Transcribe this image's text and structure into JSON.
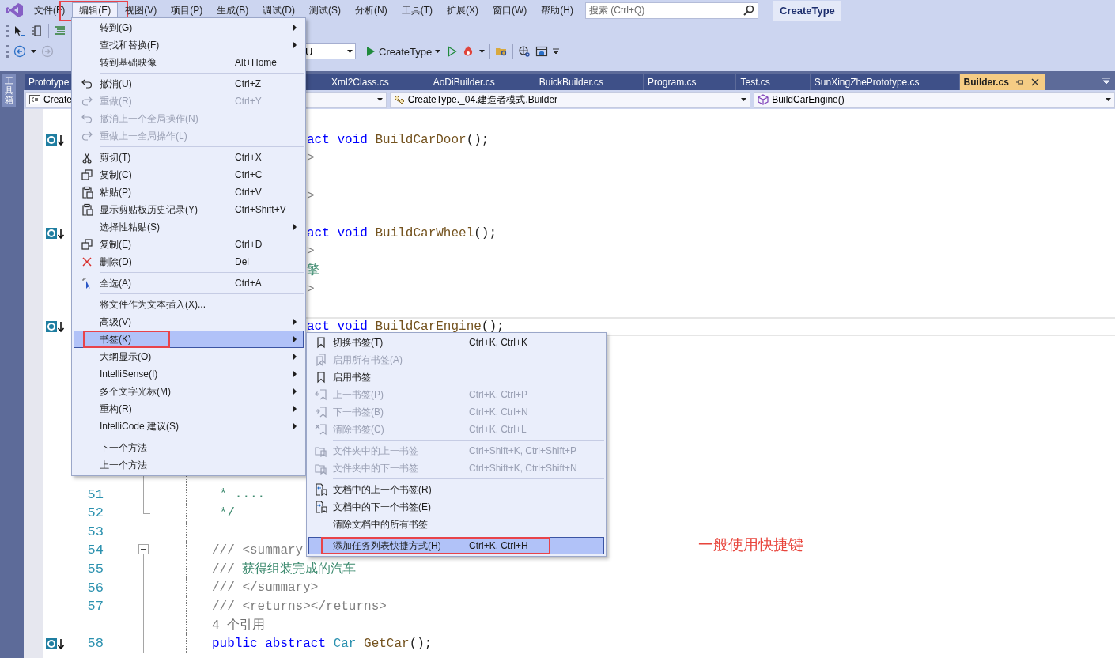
{
  "menu_bar": {
    "items": [
      {
        "label": "文件(F)",
        "selected": false,
        "annotated": false
      },
      {
        "label": "编辑(E)",
        "selected": true,
        "annotated": true
      },
      {
        "label": "视图(V)",
        "selected": false,
        "annotated": false
      },
      {
        "label": "项目(P)",
        "selected": false,
        "annotated": false
      },
      {
        "label": "生成(B)",
        "selected": false,
        "annotated": false
      },
      {
        "label": "调试(D)",
        "selected": false,
        "annotated": false
      },
      {
        "label": "测试(S)",
        "selected": false,
        "annotated": false
      },
      {
        "label": "分析(N)",
        "selected": false,
        "annotated": false
      },
      {
        "label": "工具(T)",
        "selected": false,
        "annotated": false
      },
      {
        "label": "扩展(X)",
        "selected": false,
        "annotated": false
      },
      {
        "label": "窗口(W)",
        "selected": false,
        "annotated": false
      },
      {
        "label": "帮助(H)",
        "selected": false,
        "annotated": false
      }
    ],
    "search": {
      "placeholder": "搜索 (Ctrl+Q)"
    },
    "solution_name": "CreateType"
  },
  "toolbar": {
    "config_dropdown": {
      "value": "U"
    },
    "start_button": {
      "label": "CreateType"
    }
  },
  "toolbox_tab": {
    "label": "工具箱"
  },
  "tabs": [
    {
      "label": "Prototype",
      "selected": false
    },
    {
      "label": "Xml2Class.cs",
      "selected": false
    },
    {
      "label": "AoDiBuilder.cs",
      "selected": false
    },
    {
      "label": "BuickBuilder.cs",
      "selected": false
    },
    {
      "label": "Program.cs",
      "selected": false
    },
    {
      "label": "Test.cs",
      "selected": false
    },
    {
      "label": "SunXingZhePrototype.cs",
      "selected": false
    },
    {
      "label": "Builder.cs",
      "selected": true
    }
  ],
  "nav_bar": [
    {
      "kind": "project",
      "value": "Create"
    },
    {
      "kind": "class",
      "value": "CreateType._04.建造者模式.Builder"
    },
    {
      "kind": "method",
      "value": "BuildCarEngine()"
    }
  ],
  "editor": {
    "lines": [
      {
        "kind": "clipped",
        "marker": true,
        "current": false,
        "tokens": [
          {
            "kind": "keyword",
            "text": "act void "
          },
          {
            "kind": "method",
            "text": "BuildCarDoor"
          },
          {
            "kind": "plain",
            "text": "();"
          }
        ]
      },
      {
        "kind": "clipped",
        "marker": false,
        "current": false,
        "tokens": [
          {
            "kind": "doc",
            "text": ">"
          }
        ]
      },
      {
        "kind": "blank",
        "marker": false,
        "current": false
      },
      {
        "kind": "clipped",
        "marker": false,
        "current": false,
        "tokens": [
          {
            "kind": "doc",
            "text": ">"
          }
        ]
      },
      {
        "kind": "blank",
        "marker": false,
        "current": false
      },
      {
        "kind": "clipped",
        "marker": true,
        "current": false,
        "tokens": [
          {
            "kind": "keyword",
            "text": "act void "
          },
          {
            "kind": "method",
            "text": "BuildCarWheel"
          },
          {
            "kind": "plain",
            "text": "();"
          }
        ]
      },
      {
        "kind": "clipped",
        "marker": false,
        "current": false,
        "tokens": [
          {
            "kind": "doc",
            "text": ">"
          }
        ]
      },
      {
        "kind": "clipped",
        "marker": false,
        "current": false,
        "tokens": [
          {
            "kind": "comment",
            "text": "擎"
          }
        ]
      },
      {
        "kind": "clipped",
        "marker": false,
        "current": false,
        "tokens": [
          {
            "kind": "doc",
            "text": ">"
          }
        ]
      },
      {
        "kind": "blank",
        "marker": false,
        "current": false
      },
      {
        "kind": "clipped",
        "marker": true,
        "current": true,
        "tokens": [
          {
            "kind": "keyword",
            "text": "act void "
          },
          {
            "kind": "method",
            "text": "BuildCarEngine"
          },
          {
            "kind": "plain",
            "text": "();"
          }
        ]
      },
      {
        "kind": "blank",
        "marker": false,
        "current": false
      },
      {
        "kind": "blank",
        "marker": false,
        "current": false
      },
      {
        "kind": "blank",
        "marker": false,
        "current": false
      },
      {
        "kind": "blank",
        "marker": false,
        "current": false
      },
      {
        "kind": "blank",
        "marker": false,
        "current": false
      },
      {
        "kind": "blank",
        "marker": false,
        "current": false
      },
      {
        "kind": "blank",
        "marker": false,
        "current": false
      },
      {
        "kind": "blank",
        "marker": false,
        "current": false
      },
      {
        "kind": "full",
        "number": "51",
        "marker": false,
        "current": false,
        "tokens": [
          {
            "kind": "comment",
            "text": " * ...."
          }
        ]
      },
      {
        "kind": "full",
        "number": "52",
        "marker": false,
        "current": false,
        "fold": {
          "kind": "end"
        },
        "tokens": [
          {
            "kind": "comment",
            "text": " */"
          }
        ]
      },
      {
        "kind": "full",
        "number": "53",
        "marker": false,
        "current": false,
        "fold": {
          "kind": "gap"
        }
      },
      {
        "kind": "full",
        "number": "54",
        "marker": false,
        "current": false,
        "fold": {
          "kind": "start"
        },
        "tokens": [
          {
            "kind": "doc",
            "text": "/// <summary"
          }
        ]
      },
      {
        "kind": "full",
        "number": "55",
        "marker": false,
        "current": false,
        "tokens": [
          {
            "kind": "doc",
            "text": "/// "
          },
          {
            "kind": "comment",
            "text": "获得组装完成的汽车"
          }
        ]
      },
      {
        "kind": "full",
        "number": "56",
        "marker": false,
        "current": false,
        "tokens": [
          {
            "kind": "doc",
            "text": "/// </summary>"
          }
        ]
      },
      {
        "kind": "full",
        "number": "57",
        "marker": false,
        "current": false,
        "tokens": [
          {
            "kind": "doc",
            "text": "/// <returns></returns>"
          }
        ]
      },
      {
        "kind": "lens",
        "marker": false,
        "current": false,
        "tokens": [
          {
            "kind": "lens",
            "text": "4 个引用"
          }
        ]
      },
      {
        "kind": "full",
        "number": "58",
        "marker": true,
        "current": false,
        "tokens": [
          {
            "kind": "keyword",
            "text": "public abstract "
          },
          {
            "kind": "type",
            "text": "Car "
          },
          {
            "kind": "method",
            "text": "GetCar"
          },
          {
            "kind": "plain",
            "text": "();"
          }
        ]
      }
    ],
    "note": "一般使用快捷键"
  },
  "edit_menu": {
    "items": [
      {
        "kind": "item",
        "label": "转到(G)",
        "disabled": false,
        "submenu": true,
        "selected": false,
        "annotated": false
      },
      {
        "kind": "item",
        "label": "查找和替换(F)",
        "disabled": false,
        "submenu": true,
        "selected": false,
        "annotated": false
      },
      {
        "kind": "item",
        "label": "转到基础映像",
        "shortcut": "Alt+Home",
        "disabled": false,
        "submenu": false,
        "selected": false,
        "annotated": false
      },
      {
        "kind": "separator"
      },
      {
        "kind": "item",
        "label": "撤消(U)",
        "shortcut": "Ctrl+Z",
        "disabled": false,
        "submenu": false,
        "selected": false,
        "annotated": false
      },
      {
        "kind": "item",
        "label": "重做(R)",
        "shortcut": "Ctrl+Y",
        "disabled": true,
        "submenu": false,
        "selected": false,
        "annotated": false
      },
      {
        "kind": "item",
        "label": "撤消上一个全局操作(N)",
        "disabled": true,
        "submenu": false,
        "selected": false,
        "annotated": false
      },
      {
        "kind": "item",
        "label": "重做上一全局操作(L)",
        "disabled": true,
        "submenu": false,
        "selected": false,
        "annotated": false
      },
      {
        "kind": "separator"
      },
      {
        "kind": "item",
        "label": "剪切(T)",
        "shortcut": "Ctrl+X",
        "disabled": false,
        "submenu": false,
        "selected": false,
        "annotated": false
      },
      {
        "kind": "item",
        "label": "复制(C)",
        "shortcut": "Ctrl+C",
        "disabled": false,
        "submenu": false,
        "selected": false,
        "annotated": false
      },
      {
        "kind": "item",
        "label": "粘贴(P)",
        "shortcut": "Ctrl+V",
        "disabled": false,
        "submenu": false,
        "selected": false,
        "annotated": false
      },
      {
        "kind": "item",
        "label": "显示剪贴板历史记录(Y)",
        "shortcut": "Ctrl+Shift+V",
        "disabled": false,
        "submenu": false,
        "selected": false,
        "annotated": false
      },
      {
        "kind": "item",
        "label": "选择性粘贴(S)",
        "disabled": false,
        "submenu": true,
        "selected": false,
        "annotated": false
      },
      {
        "kind": "item",
        "label": "复制(E)",
        "shortcut": "Ctrl+D",
        "disabled": false,
        "submenu": false,
        "selected": false,
        "annotated": false
      },
      {
        "kind": "item",
        "label": "删除(D)",
        "shortcut": "Del",
        "disabled": false,
        "submenu": false,
        "selected": false,
        "annotated": false
      },
      {
        "kind": "separator"
      },
      {
        "kind": "item",
        "label": "全选(A)",
        "shortcut": "Ctrl+A",
        "disabled": false,
        "submenu": false,
        "selected": false,
        "annotated": false
      },
      {
        "kind": "separator"
      },
      {
        "kind": "item",
        "label": "将文件作为文本插入(X)...",
        "disabled": false,
        "submenu": false,
        "selected": false,
        "annotated": false
      },
      {
        "kind": "item",
        "label": "高级(V)",
        "disabled": false,
        "submenu": true,
        "selected": false,
        "annotated": false
      },
      {
        "kind": "item",
        "label": "书签(K)",
        "disabled": false,
        "submenu": true,
        "selected": true,
        "annotated": true
      },
      {
        "kind": "item",
        "label": "大纲显示(O)",
        "disabled": false,
        "submenu": true,
        "selected": false,
        "annotated": false
      },
      {
        "kind": "item",
        "label": "IntelliSense(I)",
        "disabled": false,
        "submenu": true,
        "selected": false,
        "annotated": false
      },
      {
        "kind": "item",
        "label": "多个文字光标(M)",
        "disabled": false,
        "submenu": true,
        "selected": false,
        "annotated": false
      },
      {
        "kind": "item",
        "label": "重构(R)",
        "disabled": false,
        "submenu": true,
        "selected": false,
        "annotated": false
      },
      {
        "kind": "item",
        "label": "IntelliCode 建议(S)",
        "disabled": false,
        "submenu": true,
        "selected": false,
        "annotated": false
      },
      {
        "kind": "separator"
      },
      {
        "kind": "item",
        "label": "下一个方法",
        "disabled": false,
        "submenu": false,
        "selected": false,
        "annotated": false
      },
      {
        "kind": "item",
        "label": "上一个方法",
        "disabled": false,
        "submenu": false,
        "selected": false,
        "annotated": false
      }
    ]
  },
  "bookmark_submenu": {
    "items": [
      {
        "kind": "item",
        "label": "切换书签(T)",
        "shortcut": "Ctrl+K, Ctrl+K",
        "disabled": false,
        "selected": false,
        "annotated": false
      },
      {
        "kind": "item",
        "label": "启用所有书签(A)",
        "disabled": true,
        "selected": false,
        "annotated": false
      },
      {
        "kind": "item",
        "label": "启用书签",
        "disabled": false,
        "selected": false,
        "annotated": false
      },
      {
        "kind": "item",
        "label": "上一书签(P)",
        "shortcut": "Ctrl+K, Ctrl+P",
        "disabled": true,
        "selected": false,
        "annotated": false
      },
      {
        "kind": "item",
        "label": "下一书签(B)",
        "shortcut": "Ctrl+K, Ctrl+N",
        "disabled": true,
        "selected": false,
        "annotated": false
      },
      {
        "kind": "item",
        "label": "清除书签(C)",
        "shortcut": "Ctrl+K, Ctrl+L",
        "disabled": true,
        "selected": false,
        "annotated": false
      },
      {
        "kind": "separator"
      },
      {
        "kind": "item",
        "label": "文件夹中的上一书签",
        "shortcut": "Ctrl+Shift+K, Ctrl+Shift+P",
        "disabled": true,
        "selected": false,
        "annotated": false
      },
      {
        "kind": "item",
        "label": "文件夹中的下一书签",
        "shortcut": "Ctrl+Shift+K, Ctrl+Shift+N",
        "disabled": true,
        "selected": false,
        "annotated": false
      },
      {
        "kind": "separator"
      },
      {
        "kind": "item",
        "label": "文档中的上一个书签(R)",
        "disabled": false,
        "selected": false,
        "annotated": false
      },
      {
        "kind": "item",
        "label": "文档中的下一个书签(E)",
        "disabled": false,
        "selected": false,
        "annotated": false
      },
      {
        "kind": "item",
        "label": "清除文档中的所有书签",
        "disabled": false,
        "selected": false,
        "annotated": false
      },
      {
        "kind": "separator"
      },
      {
        "kind": "item",
        "label": "添加任务列表快捷方式(H)",
        "shortcut": "Ctrl+K, Ctrl+H",
        "disabled": false,
        "selected": true,
        "annotated": true
      }
    ]
  }
}
